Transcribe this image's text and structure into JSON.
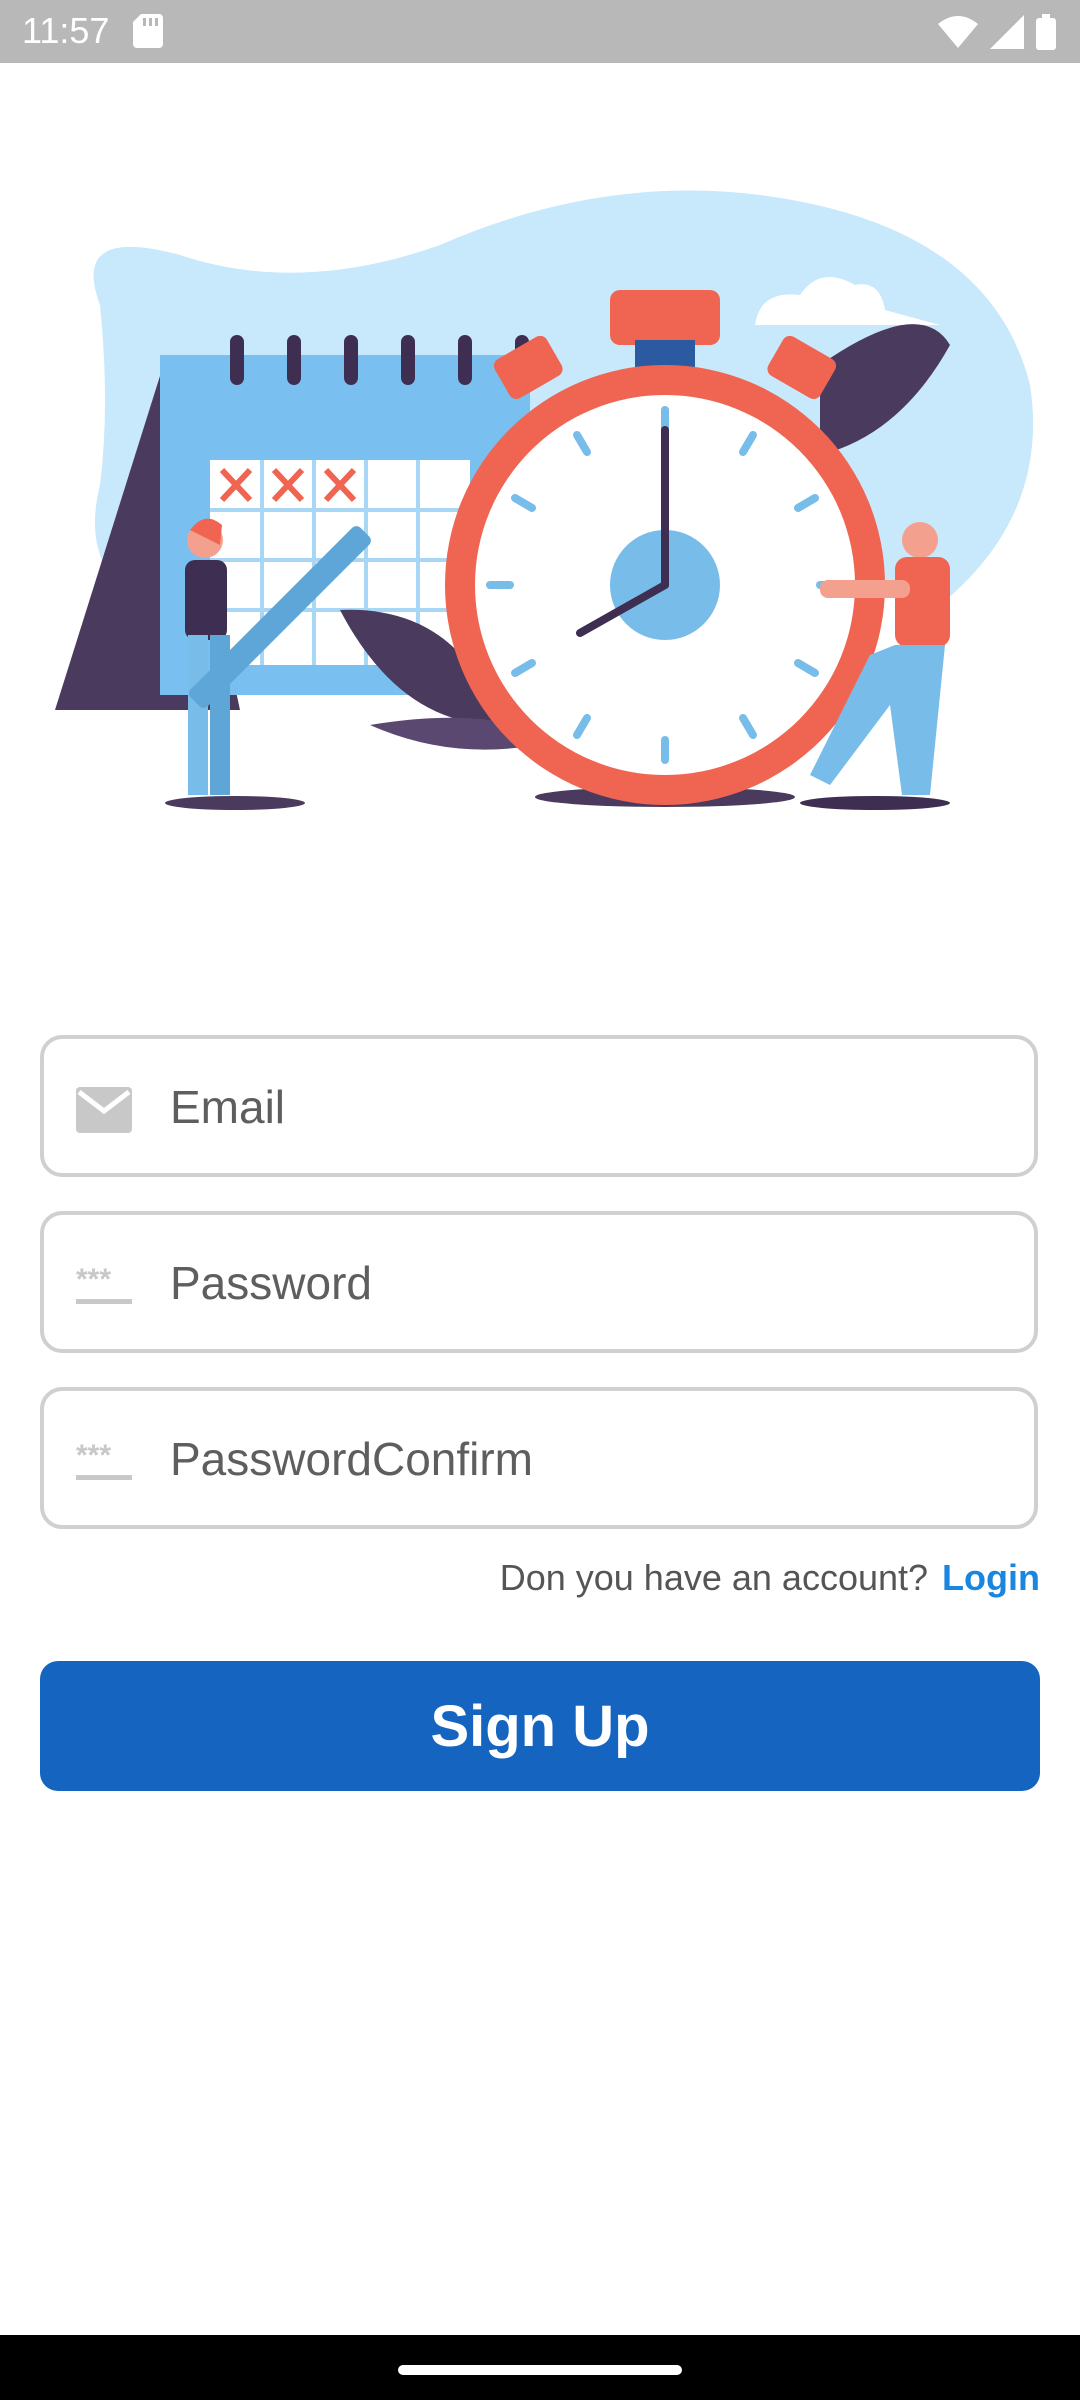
{
  "status_bar": {
    "time": "11:57",
    "icons": [
      "sd-card-icon",
      "wifi-icon",
      "signal-icon",
      "battery-icon"
    ]
  },
  "illustration": {
    "description_icon": "calendar-clock-illustration-icon"
  },
  "form": {
    "email": {
      "placeholder": "Email",
      "value": "",
      "icon": "mail-icon"
    },
    "password": {
      "placeholder": "Password",
      "value": "",
      "icon": "password-dots-icon"
    },
    "password_confirm": {
      "placeholder": "PasswordConfirm",
      "value": "",
      "icon": "password-dots-icon"
    }
  },
  "account_prompt": {
    "text": "Don you have an account?",
    "link": "Login"
  },
  "signup_button": {
    "label": "Sign Up"
  },
  "colors": {
    "primary": "#1565c0",
    "link": "#1a86e0",
    "field_border": "#d0d0d0",
    "status_bar": "#b8b8b8"
  }
}
